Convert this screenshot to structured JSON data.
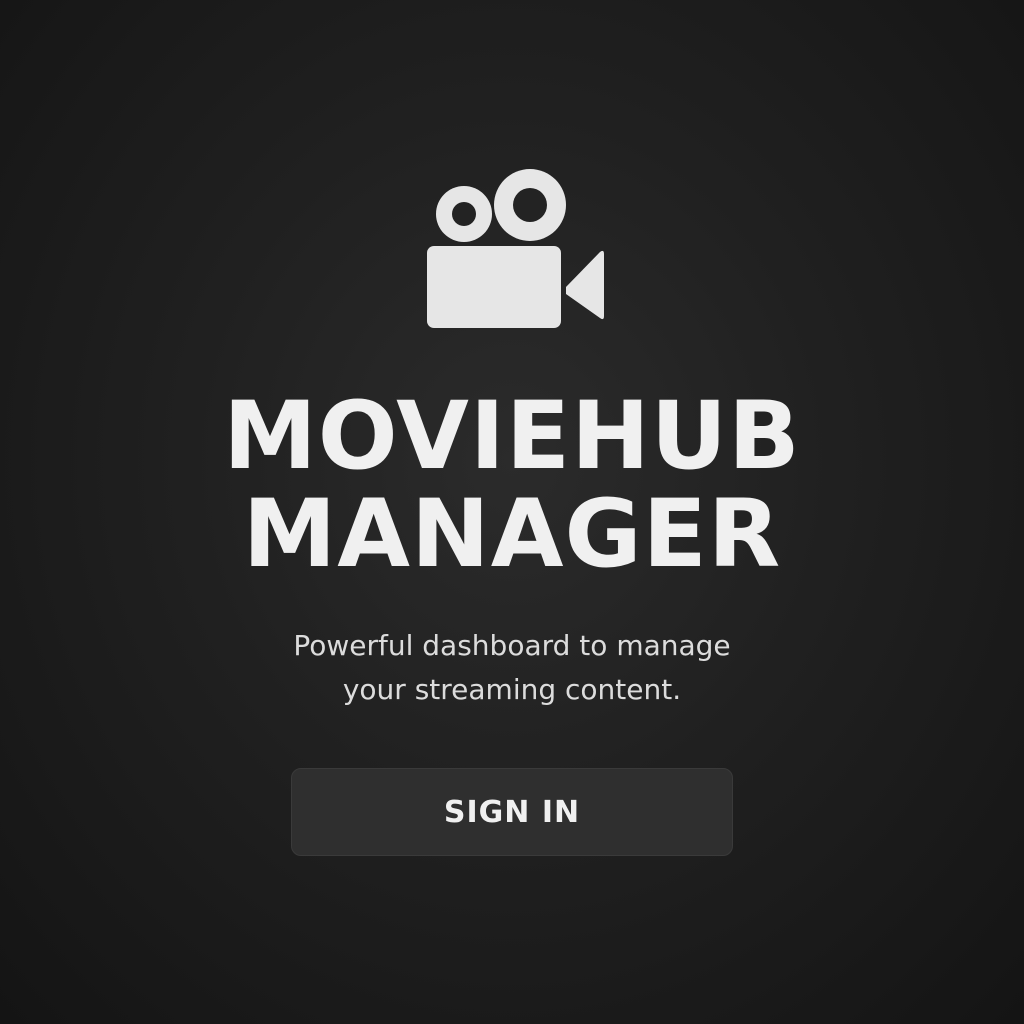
{
  "app": {
    "logo_icon": "movie-camera-icon",
    "title_line1": "MOVIEHUB",
    "title_line2": "MANAGER",
    "subtitle_line1": "Powerful dashboard to manage",
    "subtitle_line2": "your streaming content."
  },
  "actions": {
    "sign_in_label": "SIGN IN"
  },
  "colors": {
    "background": "#1c1c1c",
    "text": "#f0f0f0",
    "icon": "#e6e6e6",
    "button": "#2f2f2f"
  }
}
